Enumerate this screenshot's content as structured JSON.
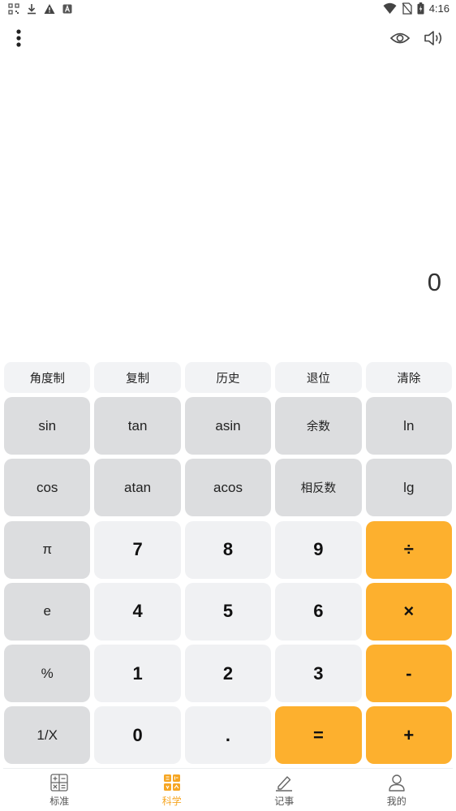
{
  "status_bar": {
    "time": "4:16",
    "left_icons": [
      "qr-notification-icon",
      "download-icon",
      "warning-icon",
      "a-square-icon"
    ],
    "right_icons": [
      "wifi-icon",
      "no-sim-icon",
      "battery-icon"
    ]
  },
  "toolbar": {
    "menu_icon": "more-vertical-icon",
    "eye_icon": "eye-icon",
    "sound_icon": "volume-icon"
  },
  "display": {
    "value": "0"
  },
  "top_row": [
    "角度制",
    "复制",
    "历史",
    "退位",
    "清除"
  ],
  "keys": [
    {
      "label": "sin",
      "kind": "func"
    },
    {
      "label": "tan",
      "kind": "func"
    },
    {
      "label": "asin",
      "kind": "func"
    },
    {
      "label": "余数",
      "kind": "func"
    },
    {
      "label": "ln",
      "kind": "func"
    },
    {
      "label": "cos",
      "kind": "func"
    },
    {
      "label": "atan",
      "kind": "func"
    },
    {
      "label": "acos",
      "kind": "func"
    },
    {
      "label": "相反数",
      "kind": "func"
    },
    {
      "label": "lg",
      "kind": "func"
    },
    {
      "label": "π",
      "kind": "func"
    },
    {
      "label": "7",
      "kind": "num"
    },
    {
      "label": "8",
      "kind": "num"
    },
    {
      "label": "9",
      "kind": "num"
    },
    {
      "label": "÷",
      "kind": "op"
    },
    {
      "label": "e",
      "kind": "func"
    },
    {
      "label": "4",
      "kind": "num"
    },
    {
      "label": "5",
      "kind": "num"
    },
    {
      "label": "6",
      "kind": "num"
    },
    {
      "label": "×",
      "kind": "op"
    },
    {
      "label": "%",
      "kind": "func"
    },
    {
      "label": "1",
      "kind": "num"
    },
    {
      "label": "2",
      "kind": "num"
    },
    {
      "label": "3",
      "kind": "num"
    },
    {
      "label": "-",
      "kind": "op"
    },
    {
      "label": "1/X",
      "kind": "func"
    },
    {
      "label": "0",
      "kind": "num"
    },
    {
      "label": ".",
      "kind": "num"
    },
    {
      "label": "=",
      "kind": "op"
    },
    {
      "label": "+",
      "kind": "op"
    }
  ],
  "bottom_nav": [
    {
      "label": "标准",
      "icon": "standard-calculator-icon",
      "active": false
    },
    {
      "label": "科学",
      "icon": "scientific-calculator-icon",
      "active": true
    },
    {
      "label": "记事",
      "icon": "notes-pencil-icon",
      "active": false
    },
    {
      "label": "我的",
      "icon": "user-profile-icon",
      "active": false
    }
  ],
  "colors": {
    "accent": "#fdb02e",
    "active_nav": "#f6a623",
    "func_key": "#dcdddf",
    "num_key": "#f0f1f3",
    "top_key": "#f2f3f5"
  }
}
